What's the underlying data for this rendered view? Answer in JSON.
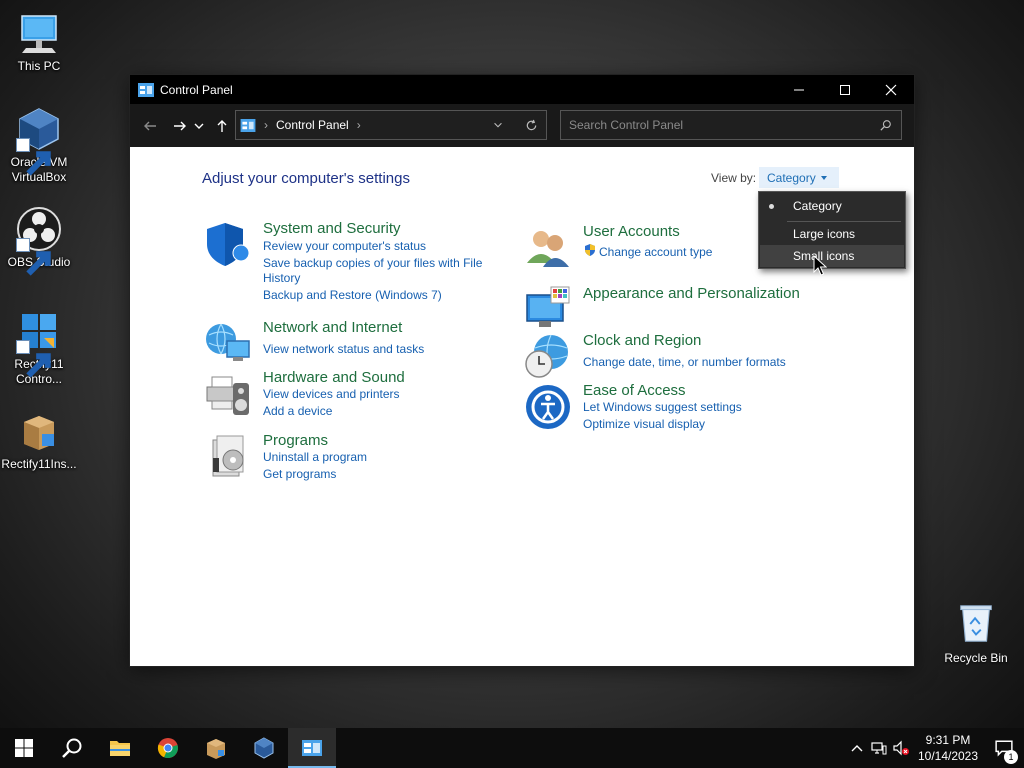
{
  "desktop": {
    "icons": [
      {
        "label": "This PC"
      },
      {
        "label": "Oracle VM VirtualBox"
      },
      {
        "label": "OBS Studio"
      },
      {
        "label": "Rectify11 Contro..."
      },
      {
        "label": "Rectify11Ins..."
      }
    ],
    "recycle_bin": "Recycle Bin"
  },
  "window": {
    "title": "Control Panel",
    "address": {
      "location": "Control Panel"
    },
    "search": {
      "placeholder": "Search Control Panel"
    },
    "heading": "Adjust your computer's settings",
    "view_by": {
      "label": "View by:",
      "selected": "Category"
    },
    "menu": {
      "items": [
        {
          "label": "Category",
          "checked": true
        },
        {
          "label": "Large icons"
        },
        {
          "label": "Small icons"
        }
      ]
    },
    "categories_left": [
      {
        "title": "System and Security",
        "links": [
          "Review your computer's status",
          "Save backup copies of your files with File",
          "History",
          "Backup and Restore (Windows 7)"
        ]
      },
      {
        "title": "Network and Internet",
        "links": [
          "View network status and tasks"
        ]
      },
      {
        "title": "Hardware and Sound",
        "links": [
          "View devices and printers",
          "Add a device"
        ]
      },
      {
        "title": "Programs",
        "links": [
          "Uninstall a program",
          "Get programs"
        ]
      }
    ],
    "categories_right": [
      {
        "title": "User Accounts",
        "links": [
          "Change account type"
        ]
      },
      {
        "title": "Appearance and Personalization",
        "links": []
      },
      {
        "title": "Clock and Region",
        "links": [
          "Change date, time, or number formats"
        ]
      },
      {
        "title": "Ease of Access",
        "links": [
          "Let Windows suggest settings",
          "Optimize visual display"
        ]
      }
    ]
  },
  "taskbar": {
    "clock": {
      "time": "9:31 PM",
      "date": "10/14/2023"
    },
    "notifications_count": "1"
  },
  "colors": {
    "category_title": "#1e6e3e",
    "link": "#1760b0",
    "heading": "#1e3287"
  }
}
